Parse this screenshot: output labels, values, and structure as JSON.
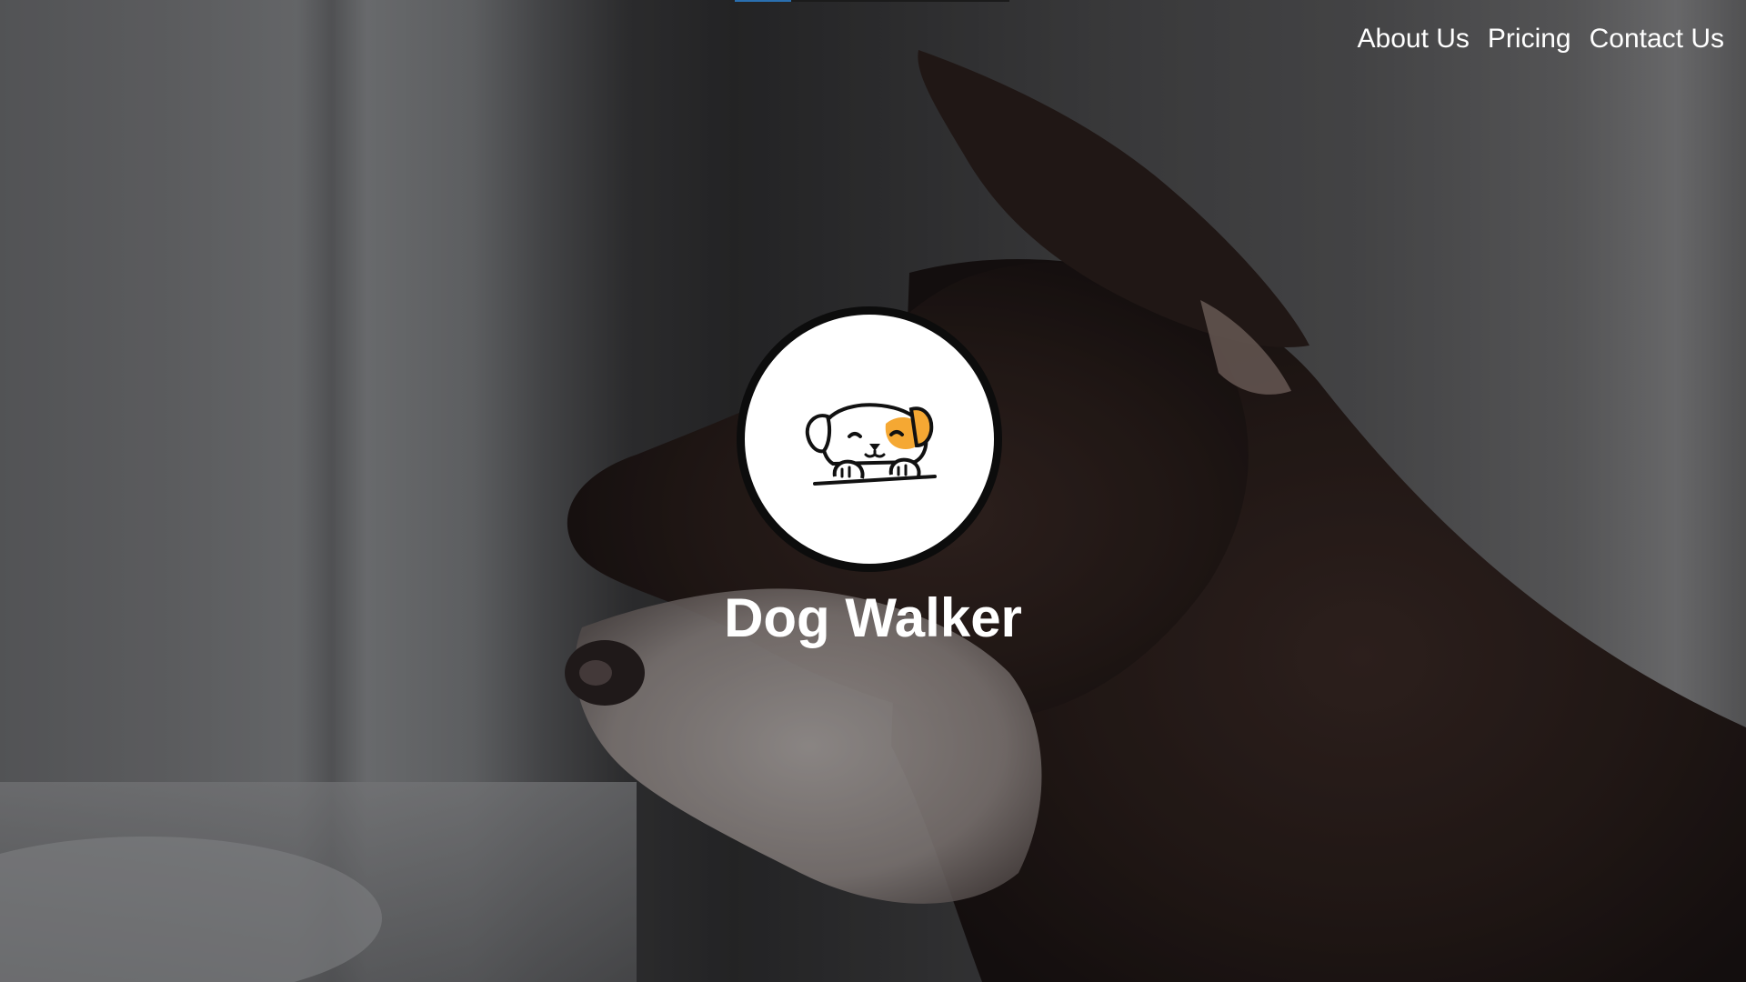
{
  "nav": {
    "items": [
      {
        "label": "About Us"
      },
      {
        "label": "Pricing"
      },
      {
        "label": "Contact Us"
      }
    ]
  },
  "hero": {
    "title": "Dog Walker",
    "background_description_icon": "dog-profile-photo",
    "logo_icon": "cartoon-dog-peeking-icon"
  },
  "colors": {
    "nav_text": "#ffffff",
    "title_text": "#ffffff",
    "logo_accent": "#f5a833",
    "logo_outline": "#0c0c0c"
  }
}
